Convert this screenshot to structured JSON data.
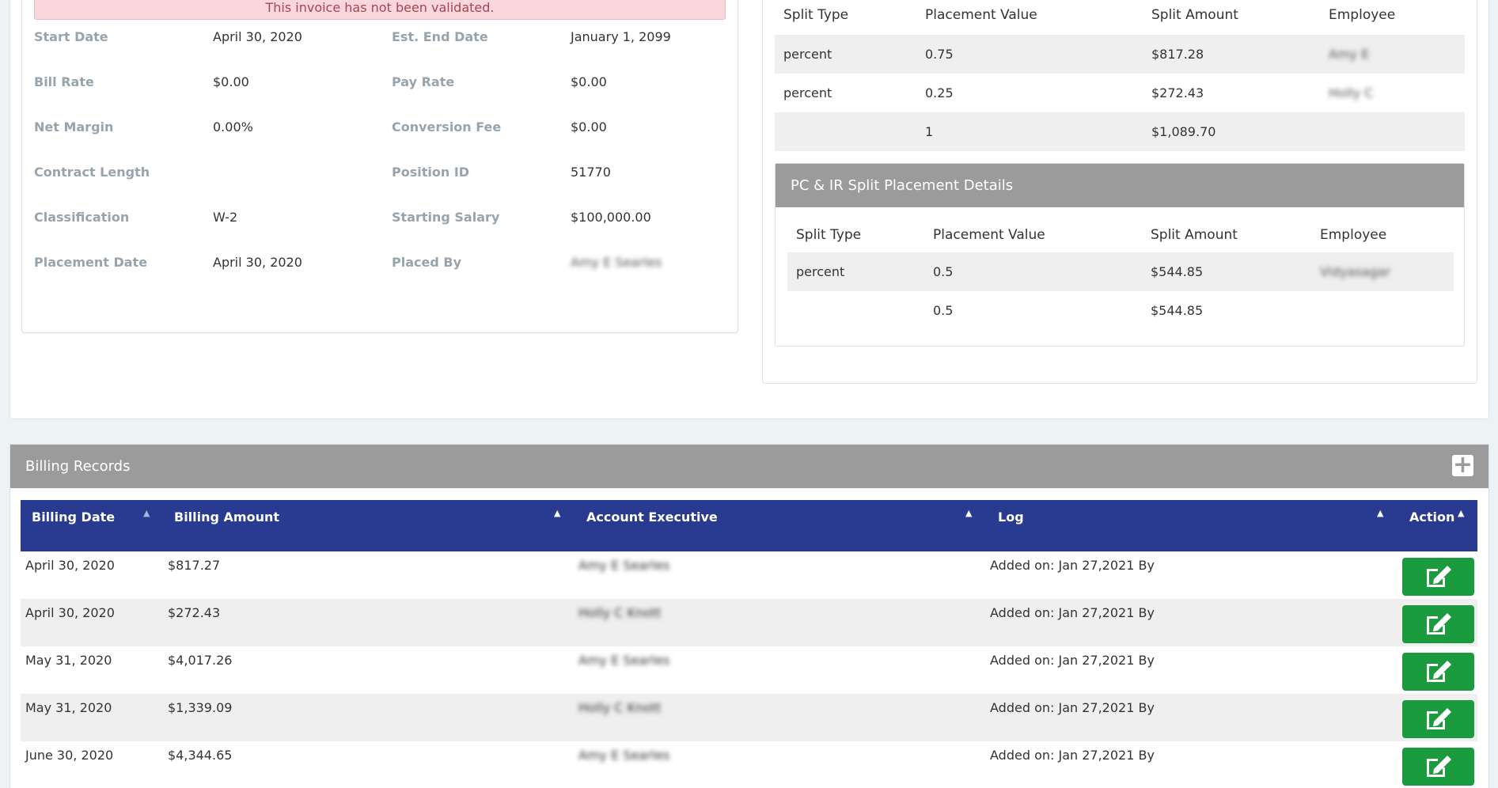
{
  "alert": "This invoice has not been validated.",
  "details": [
    {
      "label": "Start Date",
      "value": "April 30, 2020",
      "label2": "Est. End Date",
      "value2": "January 1, 2099"
    },
    {
      "label": "Bill Rate",
      "value": "$0.00",
      "label2": "Pay Rate",
      "value2": "$0.00"
    },
    {
      "label": "Net Margin",
      "value": "0.00%",
      "label2": "Conversion Fee",
      "value2": "$0.00"
    },
    {
      "label": "Contract Length",
      "value": "",
      "label2": "Position ID",
      "value2": "51770"
    },
    {
      "label": "Classification",
      "value": "W-2",
      "label2": "Starting Salary",
      "value2": "$100,000.00"
    },
    {
      "label": "Placement Date",
      "value": "April 30, 2020",
      "label2": "Placed By",
      "value2": "Amy E Searles"
    }
  ],
  "split_table": {
    "headers": [
      "Split Type",
      "Placement Value",
      "Split Amount",
      "Employee"
    ],
    "rows": [
      {
        "type": "percent",
        "value": "0.75",
        "amount": "$817.28",
        "employee": "Amy E"
      },
      {
        "type": "percent",
        "value": "0.25",
        "amount": "$272.43",
        "employee": "Holly C"
      },
      {
        "type": "",
        "value": "1",
        "amount": "$1,089.70",
        "employee": ""
      }
    ]
  },
  "pcir": {
    "title": "PC & IR Split Placement Details",
    "headers": [
      "Split Type",
      "Placement Value",
      "Split Amount",
      "Employee"
    ],
    "rows": [
      {
        "type": "percent",
        "value": "0.5",
        "amount": "$544.85",
        "employee": "Vidyasagar"
      },
      {
        "type": "",
        "value": "0.5",
        "amount": "$544.85",
        "employee": ""
      }
    ]
  },
  "billing": {
    "title": "Billing Records",
    "add_icon": "plus-icon",
    "headers": [
      "Billing Date",
      "Billing Amount",
      "Account Executive",
      "Log",
      "Action"
    ],
    "rows": [
      {
        "date": "April 30, 2020",
        "amount": "$817.27",
        "exec": "Amy E Searles",
        "log": "Added on: Jan 27,2021 By"
      },
      {
        "date": "April 30, 2020",
        "amount": "$272.43",
        "exec": "Holly C Knott",
        "log": "Added on: Jan 27,2021 By"
      },
      {
        "date": "May 31, 2020",
        "amount": "$4,017.26",
        "exec": "Amy E Searles",
        "log": "Added on: Jan 27,2021 By"
      },
      {
        "date": "May 31, 2020",
        "amount": "$1,339.09",
        "exec": "Holly C Knott",
        "log": "Added on: Jan 27,2021 By"
      },
      {
        "date": "June 30, 2020",
        "amount": "$4,344.65",
        "exec": "Amy E Searles",
        "log": "Added on: Jan 27,2021 By"
      }
    ],
    "edit_icon": "edit-icon"
  },
  "colors": {
    "table_header": "#283b90",
    "edit_button": "#1a9b3d",
    "panel_header": "#9b9b9b",
    "alert_bg": "#f9d7dc"
  }
}
